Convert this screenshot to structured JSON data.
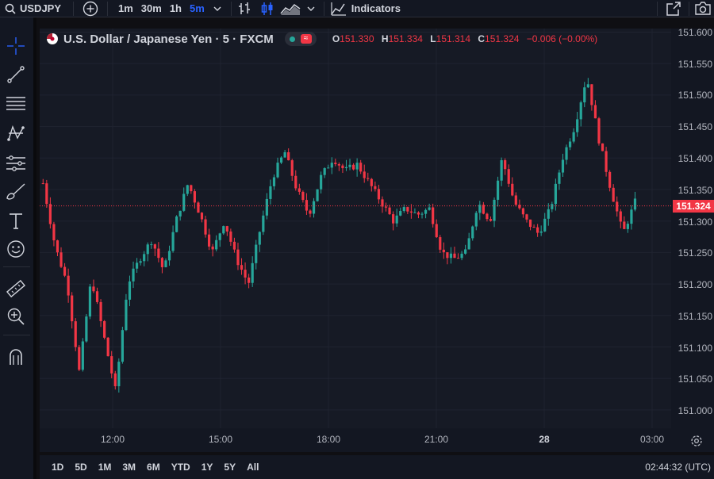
{
  "toolbar": {
    "symbol": "USDJPY",
    "timeframes": [
      "1m",
      "30m",
      "1h",
      "5m"
    ],
    "active_timeframe": "5m",
    "indicators_label": "Indicators"
  },
  "legend": {
    "title": "U.S. Dollar / Japanese Yen · 5 · FXCM",
    "open_key": "O",
    "open": "151.330",
    "high_key": "H",
    "high": "151.334",
    "low_key": "L",
    "low": "151.314",
    "close_key": "C",
    "close": "151.324",
    "change": "−0.006 (−0.00%)"
  },
  "price_axis": {
    "labels": [
      "151.600",
      "151.550",
      "151.500",
      "151.450",
      "151.400",
      "151.350",
      "151.300",
      "151.250",
      "151.200",
      "151.150",
      "151.100",
      "151.050",
      "151.000"
    ],
    "current_price": "151.324"
  },
  "time_axis": {
    "labels": [
      "12:00",
      "15:00",
      "18:00",
      "21:00",
      "28",
      "03:00"
    ]
  },
  "bottom": {
    "ranges": [
      "1D",
      "5D",
      "1M",
      "3M",
      "6M",
      "YTD",
      "1Y",
      "5Y",
      "All"
    ],
    "clock": "02:44:32 (UTC)"
  },
  "colors": {
    "up": "#26a69a",
    "down": "#f23645",
    "accent": "#2962ff",
    "background": "#161a25"
  },
  "icons": [
    "search-icon",
    "add-symbol-icon",
    "chevron-down-icon",
    "bar-chart-icon",
    "candle-chart-icon",
    "area-chart-icon",
    "indicators-icon",
    "fullscreen-icon",
    "camera-icon",
    "crosshair-icon",
    "trend-line-icon",
    "fib-icon",
    "pattern-icon",
    "projection-icon",
    "brush-icon",
    "text-icon",
    "emoji-icon",
    "ruler-icon",
    "zoom-icon",
    "magnet-icon",
    "flag-icon",
    "settings-icon"
  ],
  "chart_data": {
    "type": "candlestick",
    "symbol": "USDJPY",
    "interval": "5",
    "source": "FXCM",
    "ylim": [
      151.0,
      151.6
    ],
    "last_price": 151.324,
    "ohlc_path": [
      151.36,
      151.26,
      151.2,
      151.06,
      151.21,
      151.12,
      151.03,
      151.2,
      151.24,
      151.27,
      151.22,
      151.3,
      151.36,
      151.31,
      151.25,
      151.3,
      151.24,
      151.2,
      151.29,
      151.37,
      151.41,
      151.35,
      151.31,
      151.37,
      151.4,
      151.38,
      151.39,
      151.36,
      151.33,
      151.3,
      151.32,
      151.31,
      151.32,
      151.25,
      151.24,
      151.25,
      151.33,
      151.3,
      151.4,
      151.33,
      151.3,
      151.28,
      151.32,
      151.4,
      151.45,
      151.53,
      151.43,
      151.35,
      151.28,
      151.33
    ]
  }
}
